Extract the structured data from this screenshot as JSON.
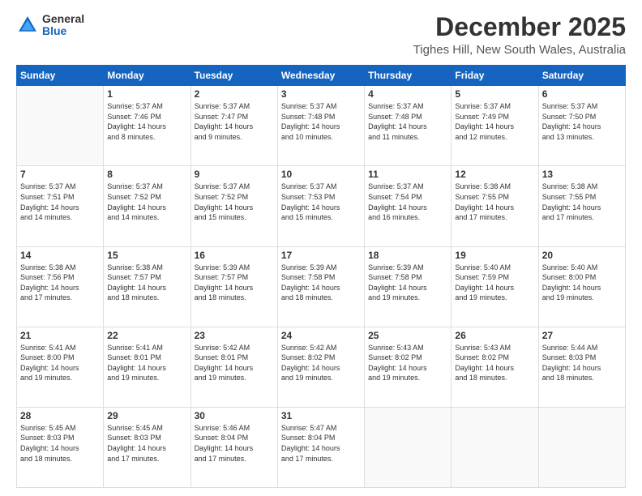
{
  "header": {
    "logo": {
      "general": "General",
      "blue": "Blue"
    },
    "month": "December 2025",
    "location": "Tighes Hill, New South Wales, Australia"
  },
  "days_of_week": [
    "Sunday",
    "Monday",
    "Tuesday",
    "Wednesday",
    "Thursday",
    "Friday",
    "Saturday"
  ],
  "weeks": [
    [
      {
        "day": "",
        "info": ""
      },
      {
        "day": "1",
        "info": "Sunrise: 5:37 AM\nSunset: 7:46 PM\nDaylight: 14 hours\nand 8 minutes."
      },
      {
        "day": "2",
        "info": "Sunrise: 5:37 AM\nSunset: 7:47 PM\nDaylight: 14 hours\nand 9 minutes."
      },
      {
        "day": "3",
        "info": "Sunrise: 5:37 AM\nSunset: 7:48 PM\nDaylight: 14 hours\nand 10 minutes."
      },
      {
        "day": "4",
        "info": "Sunrise: 5:37 AM\nSunset: 7:48 PM\nDaylight: 14 hours\nand 11 minutes."
      },
      {
        "day": "5",
        "info": "Sunrise: 5:37 AM\nSunset: 7:49 PM\nDaylight: 14 hours\nand 12 minutes."
      },
      {
        "day": "6",
        "info": "Sunrise: 5:37 AM\nSunset: 7:50 PM\nDaylight: 14 hours\nand 13 minutes."
      }
    ],
    [
      {
        "day": "7",
        "info": "Sunrise: 5:37 AM\nSunset: 7:51 PM\nDaylight: 14 hours\nand 14 minutes."
      },
      {
        "day": "8",
        "info": "Sunrise: 5:37 AM\nSunset: 7:52 PM\nDaylight: 14 hours\nand 14 minutes."
      },
      {
        "day": "9",
        "info": "Sunrise: 5:37 AM\nSunset: 7:52 PM\nDaylight: 14 hours\nand 15 minutes."
      },
      {
        "day": "10",
        "info": "Sunrise: 5:37 AM\nSunset: 7:53 PM\nDaylight: 14 hours\nand 15 minutes."
      },
      {
        "day": "11",
        "info": "Sunrise: 5:37 AM\nSunset: 7:54 PM\nDaylight: 14 hours\nand 16 minutes."
      },
      {
        "day": "12",
        "info": "Sunrise: 5:38 AM\nSunset: 7:55 PM\nDaylight: 14 hours\nand 17 minutes."
      },
      {
        "day": "13",
        "info": "Sunrise: 5:38 AM\nSunset: 7:55 PM\nDaylight: 14 hours\nand 17 minutes."
      }
    ],
    [
      {
        "day": "14",
        "info": "Sunrise: 5:38 AM\nSunset: 7:56 PM\nDaylight: 14 hours\nand 17 minutes."
      },
      {
        "day": "15",
        "info": "Sunrise: 5:38 AM\nSunset: 7:57 PM\nDaylight: 14 hours\nand 18 minutes."
      },
      {
        "day": "16",
        "info": "Sunrise: 5:39 AM\nSunset: 7:57 PM\nDaylight: 14 hours\nand 18 minutes."
      },
      {
        "day": "17",
        "info": "Sunrise: 5:39 AM\nSunset: 7:58 PM\nDaylight: 14 hours\nand 18 minutes."
      },
      {
        "day": "18",
        "info": "Sunrise: 5:39 AM\nSunset: 7:58 PM\nDaylight: 14 hours\nand 19 minutes."
      },
      {
        "day": "19",
        "info": "Sunrise: 5:40 AM\nSunset: 7:59 PM\nDaylight: 14 hours\nand 19 minutes."
      },
      {
        "day": "20",
        "info": "Sunrise: 5:40 AM\nSunset: 8:00 PM\nDaylight: 14 hours\nand 19 minutes."
      }
    ],
    [
      {
        "day": "21",
        "info": "Sunrise: 5:41 AM\nSunset: 8:00 PM\nDaylight: 14 hours\nand 19 minutes."
      },
      {
        "day": "22",
        "info": "Sunrise: 5:41 AM\nSunset: 8:01 PM\nDaylight: 14 hours\nand 19 minutes."
      },
      {
        "day": "23",
        "info": "Sunrise: 5:42 AM\nSunset: 8:01 PM\nDaylight: 14 hours\nand 19 minutes."
      },
      {
        "day": "24",
        "info": "Sunrise: 5:42 AM\nSunset: 8:02 PM\nDaylight: 14 hours\nand 19 minutes."
      },
      {
        "day": "25",
        "info": "Sunrise: 5:43 AM\nSunset: 8:02 PM\nDaylight: 14 hours\nand 19 minutes."
      },
      {
        "day": "26",
        "info": "Sunrise: 5:43 AM\nSunset: 8:02 PM\nDaylight: 14 hours\nand 18 minutes."
      },
      {
        "day": "27",
        "info": "Sunrise: 5:44 AM\nSunset: 8:03 PM\nDaylight: 14 hours\nand 18 minutes."
      }
    ],
    [
      {
        "day": "28",
        "info": "Sunrise: 5:45 AM\nSunset: 8:03 PM\nDaylight: 14 hours\nand 18 minutes."
      },
      {
        "day": "29",
        "info": "Sunrise: 5:45 AM\nSunset: 8:03 PM\nDaylight: 14 hours\nand 17 minutes."
      },
      {
        "day": "30",
        "info": "Sunrise: 5:46 AM\nSunset: 8:04 PM\nDaylight: 14 hours\nand 17 minutes."
      },
      {
        "day": "31",
        "info": "Sunrise: 5:47 AM\nSunset: 8:04 PM\nDaylight: 14 hours\nand 17 minutes."
      },
      {
        "day": "",
        "info": ""
      },
      {
        "day": "",
        "info": ""
      },
      {
        "day": "",
        "info": ""
      }
    ]
  ]
}
